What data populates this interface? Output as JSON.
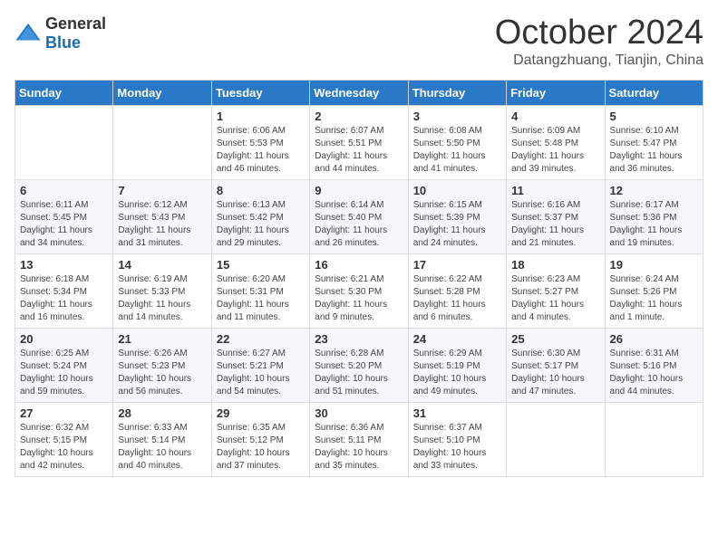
{
  "header": {
    "logo_general": "General",
    "logo_blue": "Blue",
    "month": "October 2024",
    "location": "Datangzhuang, Tianjin, China"
  },
  "weekdays": [
    "Sunday",
    "Monday",
    "Tuesday",
    "Wednesday",
    "Thursday",
    "Friday",
    "Saturday"
  ],
  "weeks": [
    [
      {
        "day": "",
        "sunrise": "",
        "sunset": "",
        "daylight": ""
      },
      {
        "day": "",
        "sunrise": "",
        "sunset": "",
        "daylight": ""
      },
      {
        "day": "1",
        "sunrise": "Sunrise: 6:06 AM",
        "sunset": "Sunset: 5:53 PM",
        "daylight": "Daylight: 11 hours and 46 minutes."
      },
      {
        "day": "2",
        "sunrise": "Sunrise: 6:07 AM",
        "sunset": "Sunset: 5:51 PM",
        "daylight": "Daylight: 11 hours and 44 minutes."
      },
      {
        "day": "3",
        "sunrise": "Sunrise: 6:08 AM",
        "sunset": "Sunset: 5:50 PM",
        "daylight": "Daylight: 11 hours and 41 minutes."
      },
      {
        "day": "4",
        "sunrise": "Sunrise: 6:09 AM",
        "sunset": "Sunset: 5:48 PM",
        "daylight": "Daylight: 11 hours and 39 minutes."
      },
      {
        "day": "5",
        "sunrise": "Sunrise: 6:10 AM",
        "sunset": "Sunset: 5:47 PM",
        "daylight": "Daylight: 11 hours and 36 minutes."
      }
    ],
    [
      {
        "day": "6",
        "sunrise": "Sunrise: 6:11 AM",
        "sunset": "Sunset: 5:45 PM",
        "daylight": "Daylight: 11 hours and 34 minutes."
      },
      {
        "day": "7",
        "sunrise": "Sunrise: 6:12 AM",
        "sunset": "Sunset: 5:43 PM",
        "daylight": "Daylight: 11 hours and 31 minutes."
      },
      {
        "day": "8",
        "sunrise": "Sunrise: 6:13 AM",
        "sunset": "Sunset: 5:42 PM",
        "daylight": "Daylight: 11 hours and 29 minutes."
      },
      {
        "day": "9",
        "sunrise": "Sunrise: 6:14 AM",
        "sunset": "Sunset: 5:40 PM",
        "daylight": "Daylight: 11 hours and 26 minutes."
      },
      {
        "day": "10",
        "sunrise": "Sunrise: 6:15 AM",
        "sunset": "Sunset: 5:39 PM",
        "daylight": "Daylight: 11 hours and 24 minutes."
      },
      {
        "day": "11",
        "sunrise": "Sunrise: 6:16 AM",
        "sunset": "Sunset: 5:37 PM",
        "daylight": "Daylight: 11 hours and 21 minutes."
      },
      {
        "day": "12",
        "sunrise": "Sunrise: 6:17 AM",
        "sunset": "Sunset: 5:36 PM",
        "daylight": "Daylight: 11 hours and 19 minutes."
      }
    ],
    [
      {
        "day": "13",
        "sunrise": "Sunrise: 6:18 AM",
        "sunset": "Sunset: 5:34 PM",
        "daylight": "Daylight: 11 hours and 16 minutes."
      },
      {
        "day": "14",
        "sunrise": "Sunrise: 6:19 AM",
        "sunset": "Sunset: 5:33 PM",
        "daylight": "Daylight: 11 hours and 14 minutes."
      },
      {
        "day": "15",
        "sunrise": "Sunrise: 6:20 AM",
        "sunset": "Sunset: 5:31 PM",
        "daylight": "Daylight: 11 hours and 11 minutes."
      },
      {
        "day": "16",
        "sunrise": "Sunrise: 6:21 AM",
        "sunset": "Sunset: 5:30 PM",
        "daylight": "Daylight: 11 hours and 9 minutes."
      },
      {
        "day": "17",
        "sunrise": "Sunrise: 6:22 AM",
        "sunset": "Sunset: 5:28 PM",
        "daylight": "Daylight: 11 hours and 6 minutes."
      },
      {
        "day": "18",
        "sunrise": "Sunrise: 6:23 AM",
        "sunset": "Sunset: 5:27 PM",
        "daylight": "Daylight: 11 hours and 4 minutes."
      },
      {
        "day": "19",
        "sunrise": "Sunrise: 6:24 AM",
        "sunset": "Sunset: 5:26 PM",
        "daylight": "Daylight: 11 hours and 1 minute."
      }
    ],
    [
      {
        "day": "20",
        "sunrise": "Sunrise: 6:25 AM",
        "sunset": "Sunset: 5:24 PM",
        "daylight": "Daylight: 10 hours and 59 minutes."
      },
      {
        "day": "21",
        "sunrise": "Sunrise: 6:26 AM",
        "sunset": "Sunset: 5:23 PM",
        "daylight": "Daylight: 10 hours and 56 minutes."
      },
      {
        "day": "22",
        "sunrise": "Sunrise: 6:27 AM",
        "sunset": "Sunset: 5:21 PM",
        "daylight": "Daylight: 10 hours and 54 minutes."
      },
      {
        "day": "23",
        "sunrise": "Sunrise: 6:28 AM",
        "sunset": "Sunset: 5:20 PM",
        "daylight": "Daylight: 10 hours and 51 minutes."
      },
      {
        "day": "24",
        "sunrise": "Sunrise: 6:29 AM",
        "sunset": "Sunset: 5:19 PM",
        "daylight": "Daylight: 10 hours and 49 minutes."
      },
      {
        "day": "25",
        "sunrise": "Sunrise: 6:30 AM",
        "sunset": "Sunset: 5:17 PM",
        "daylight": "Daylight: 10 hours and 47 minutes."
      },
      {
        "day": "26",
        "sunrise": "Sunrise: 6:31 AM",
        "sunset": "Sunset: 5:16 PM",
        "daylight": "Daylight: 10 hours and 44 minutes."
      }
    ],
    [
      {
        "day": "27",
        "sunrise": "Sunrise: 6:32 AM",
        "sunset": "Sunset: 5:15 PM",
        "daylight": "Daylight: 10 hours and 42 minutes."
      },
      {
        "day": "28",
        "sunrise": "Sunrise: 6:33 AM",
        "sunset": "Sunset: 5:14 PM",
        "daylight": "Daylight: 10 hours and 40 minutes."
      },
      {
        "day": "29",
        "sunrise": "Sunrise: 6:35 AM",
        "sunset": "Sunset: 5:12 PM",
        "daylight": "Daylight: 10 hours and 37 minutes."
      },
      {
        "day": "30",
        "sunrise": "Sunrise: 6:36 AM",
        "sunset": "Sunset: 5:11 PM",
        "daylight": "Daylight: 10 hours and 35 minutes."
      },
      {
        "day": "31",
        "sunrise": "Sunrise: 6:37 AM",
        "sunset": "Sunset: 5:10 PM",
        "daylight": "Daylight: 10 hours and 33 minutes."
      },
      {
        "day": "",
        "sunrise": "",
        "sunset": "",
        "daylight": ""
      },
      {
        "day": "",
        "sunrise": "",
        "sunset": "",
        "daylight": ""
      }
    ]
  ]
}
